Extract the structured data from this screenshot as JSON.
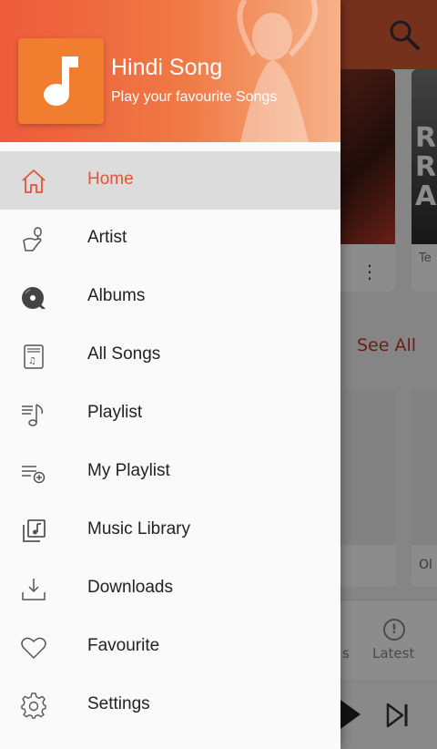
{
  "header": {
    "app_title": "Hindi Song",
    "app_subtitle": "Play your favourite Songs"
  },
  "menu": {
    "active_index": 0,
    "items": [
      {
        "label": "Home",
        "icon": "home-icon"
      },
      {
        "label": "Artist",
        "icon": "artist-icon"
      },
      {
        "label": "Albums",
        "icon": "album-icon"
      },
      {
        "label": "All Songs",
        "icon": "all-songs-icon"
      },
      {
        "label": "Playlist",
        "icon": "playlist-icon"
      },
      {
        "label": "My Playlist",
        "icon": "my-playlist-icon"
      },
      {
        "label": "Music Library",
        "icon": "music-library-icon"
      },
      {
        "label": "Downloads",
        "icon": "downloads-icon"
      },
      {
        "label": "Favourite",
        "icon": "favourite-icon"
      },
      {
        "label": "Settings",
        "icon": "settings-icon"
      }
    ]
  },
  "background": {
    "see_all": "See All",
    "tab_latest": "Latest",
    "tab_partial": "s",
    "card_partial_text": "Te",
    "card_partial_text2": "Ol"
  },
  "colors": {
    "accent": "#e0553a",
    "header_start": "#ee5a3a",
    "header_end": "#f6b28a"
  }
}
